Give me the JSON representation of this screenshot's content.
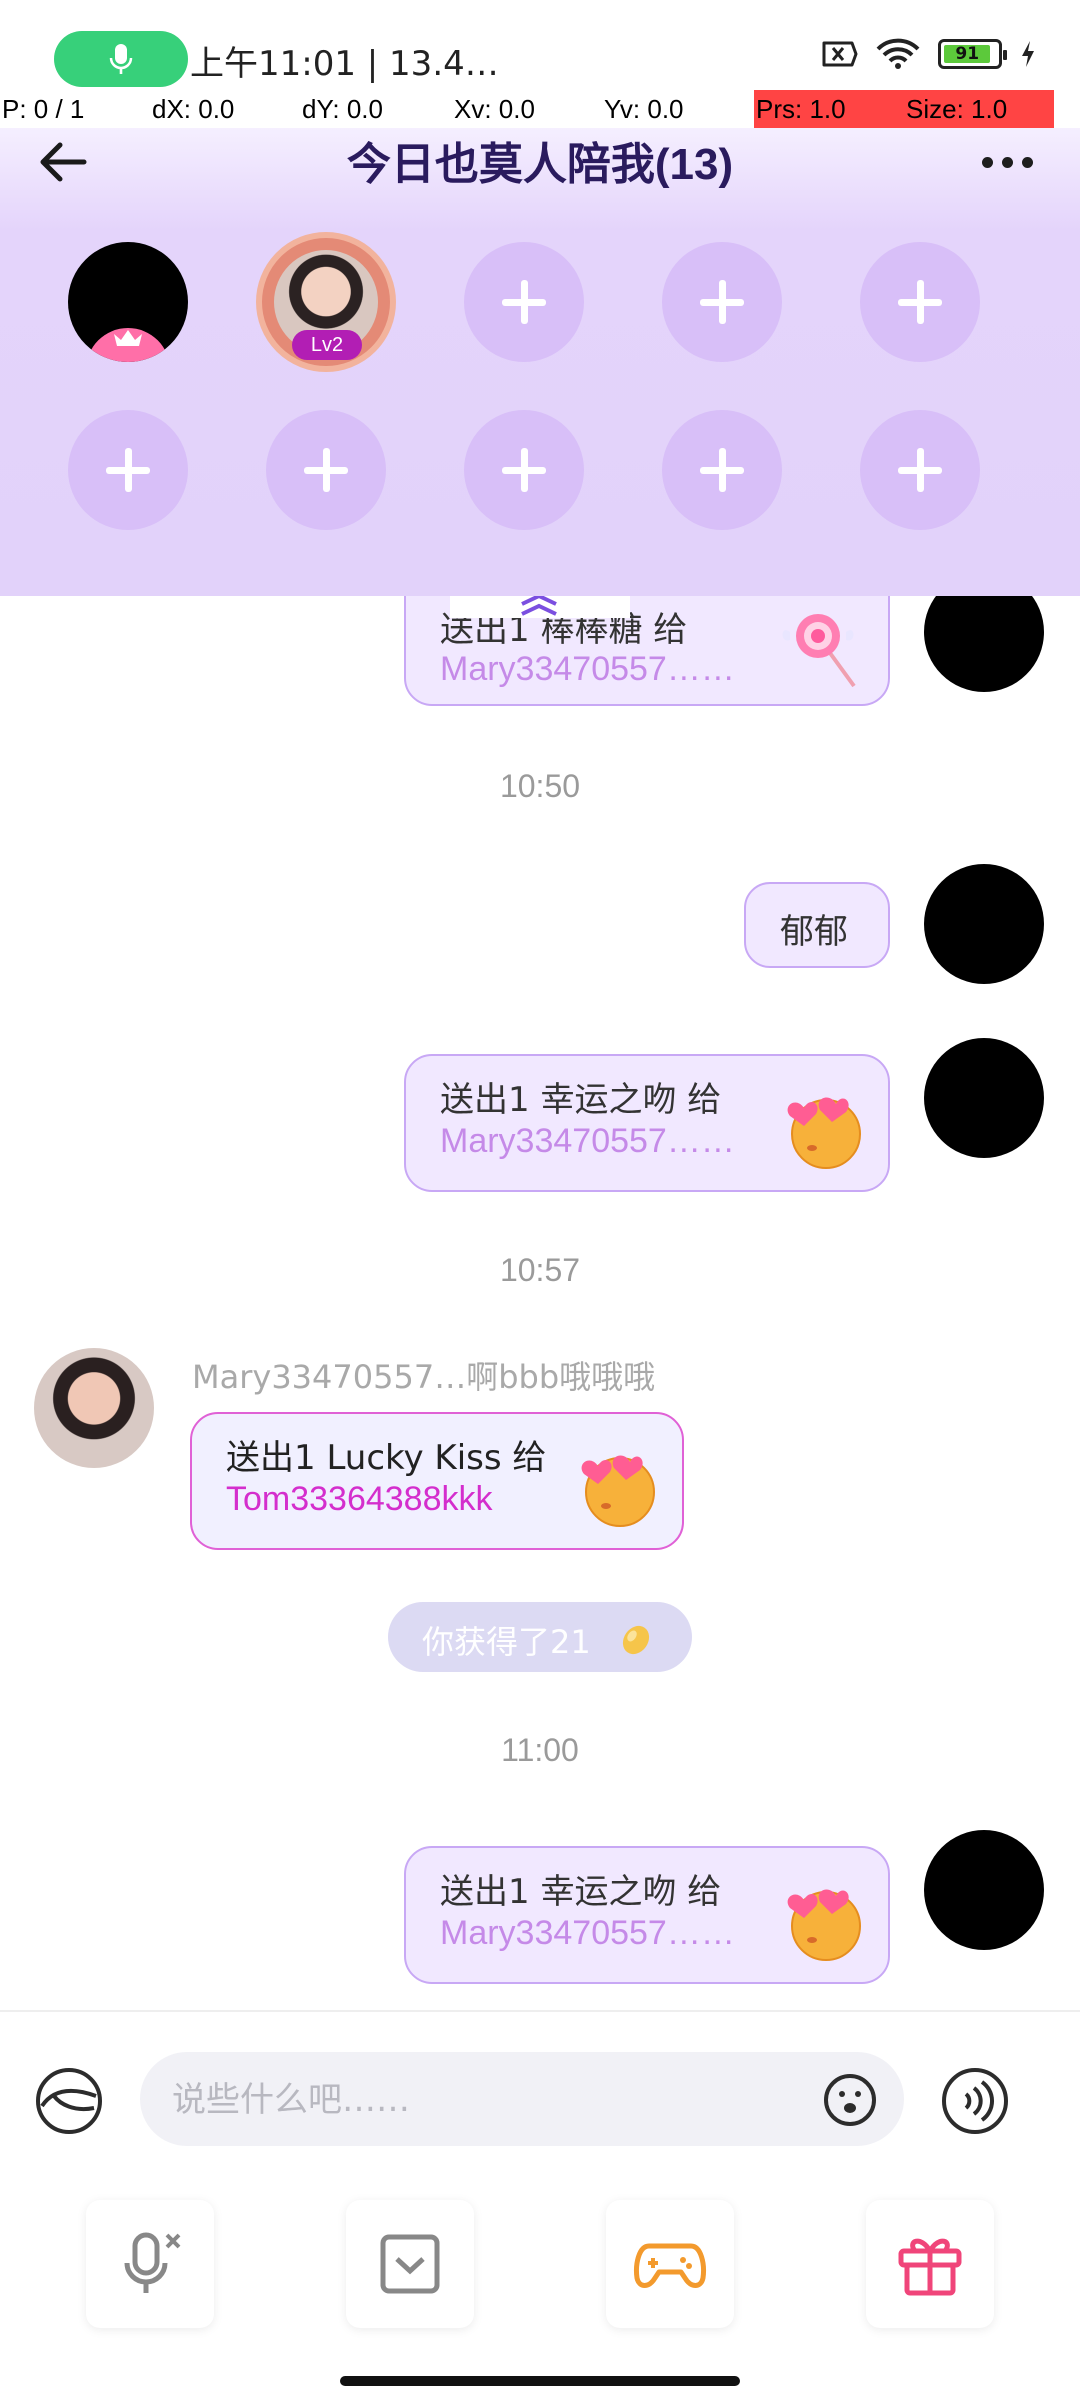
{
  "status_bar": {
    "time": "上午11:01 | 13.4…",
    "battery": "91"
  },
  "debug": {
    "p": "P: 0 / 1",
    "dx": "dX: 0.0",
    "dy": "dY: 0.0",
    "xv": "Xv: 0.0",
    "yv": "Yv: 0.0",
    "prs": "Prs: 1.0",
    "size": "Size: 1.0"
  },
  "header": {
    "title": "今日也莫人陪我(13)",
    "level_badge": "Lv2"
  },
  "messages": {
    "msg_partial_line1": "送出1 棒棒糖 给",
    "msg_partial_line2": "Mary33470557……",
    "time_1": "10:50",
    "text_1": "郁郁",
    "gift_1_line1": "送出1 幸运之吻 给",
    "gift_1_line2": "Mary33470557……",
    "time_2": "10:57",
    "sender_name": "Mary33470557…啊bbb哦哦哦",
    "gift_2_line1": "送出1 Lucky Kiss 给",
    "gift_2_line2": "Tom33364388kkk",
    "system_notice": "你获得了21",
    "time_3": "11:00",
    "gift_3_line1": "送出1 幸运之吻 给",
    "gift_3_line2": "Mary33470557……"
  },
  "input": {
    "placeholder": "说些什么吧……",
    "value": ""
  },
  "colors": {
    "accent": "#c58ae8",
    "bubble_bg": "#f1e8ff",
    "header_bg": "#e2d2fa",
    "seat_bg": "#d8bff8"
  }
}
